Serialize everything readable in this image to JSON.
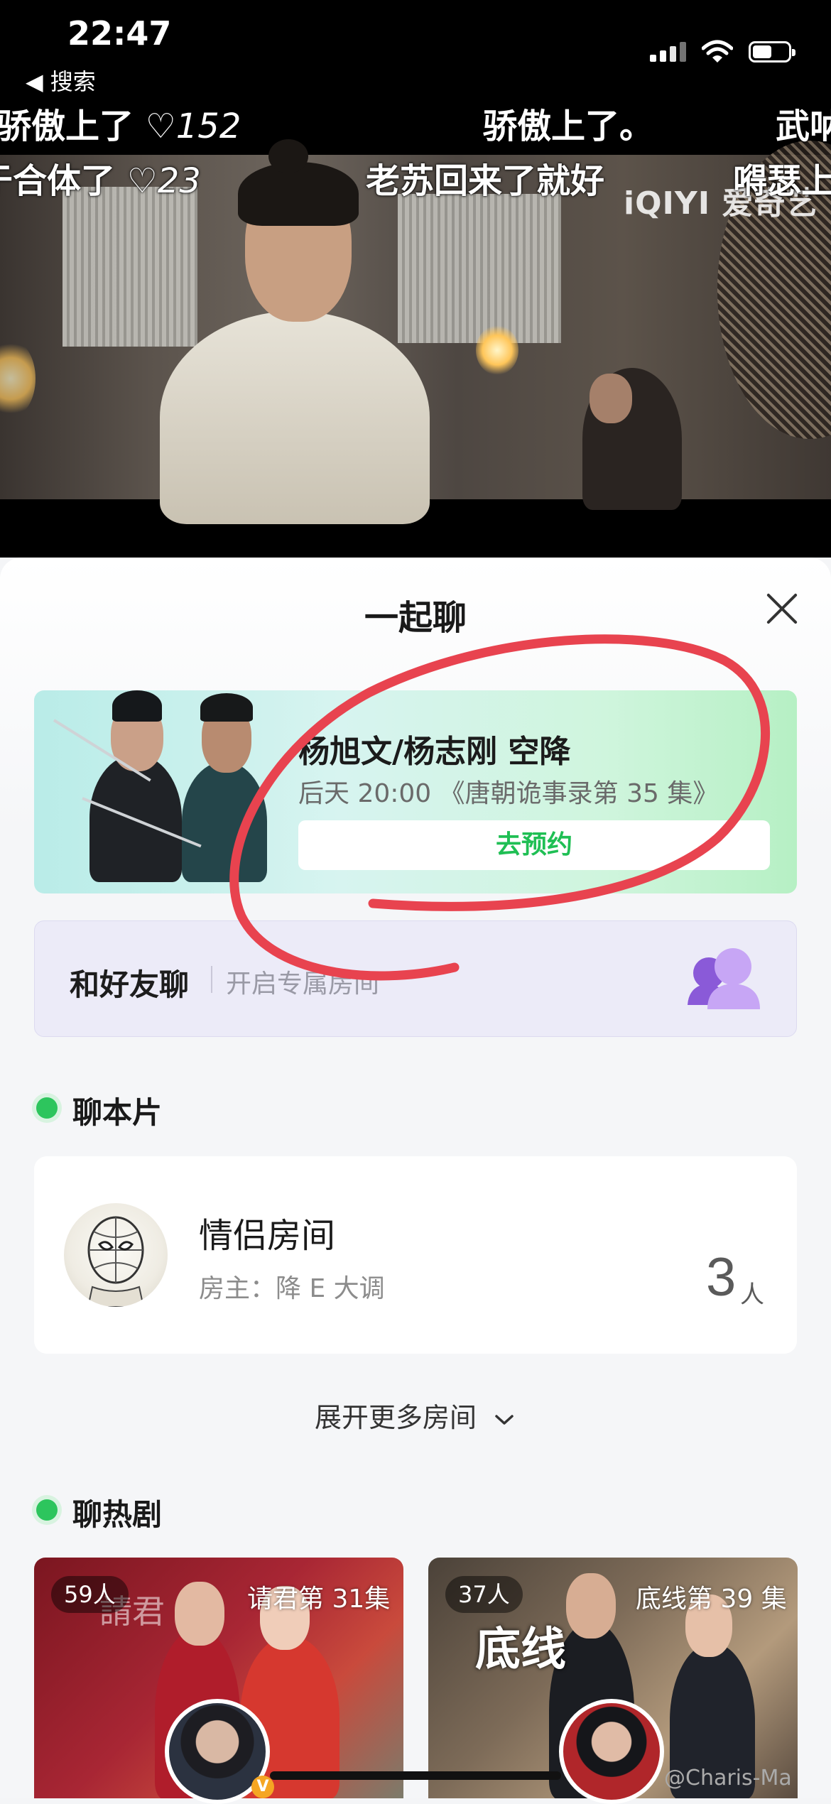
{
  "status_bar": {
    "time": "22:47",
    "back_label": "◀ 搜索",
    "battery_level": 0.55
  },
  "danmaku": [
    {
      "text": "骄傲上了",
      "heart": "♡",
      "count": "152"
    },
    {
      "text": "骄傲上了。"
    },
    {
      "text": "武呐"
    },
    {
      "text": "于合体了",
      "heart": "♡",
      "count": "23"
    },
    {
      "text": "老苏回来了就好"
    },
    {
      "text": "嘚瑟上"
    }
  ],
  "video_logo": "iQIYI 爱奇艺",
  "sheet": {
    "title": "一起聊",
    "promo": {
      "title": "杨旭文/杨志刚 空降",
      "subtitle": "后天 20:00 《唐朝诡事录第 35 集》",
      "button": "去预约"
    },
    "friend_chat": {
      "title": "和好友聊",
      "subtitle": "开启专属房间"
    },
    "section_script": {
      "title": "聊本片"
    },
    "room": {
      "name": "情侣房间",
      "host": "房主：降 E 大调",
      "count": "3",
      "unit": "人"
    },
    "expand_label": "展开更多房间",
    "section_hot": {
      "title": "聊热剧"
    },
    "cards": [
      {
        "viewers": "59人",
        "episode": "请君第 31集",
        "poster_text": "請君"
      },
      {
        "viewers": "37人",
        "episode": "底线第 39 集",
        "poster_text": "底线"
      }
    ]
  },
  "watermark": "@Charis-Ma",
  "colors": {
    "accent_green": "#1fbf54",
    "annotation_red": "#e8434f"
  }
}
